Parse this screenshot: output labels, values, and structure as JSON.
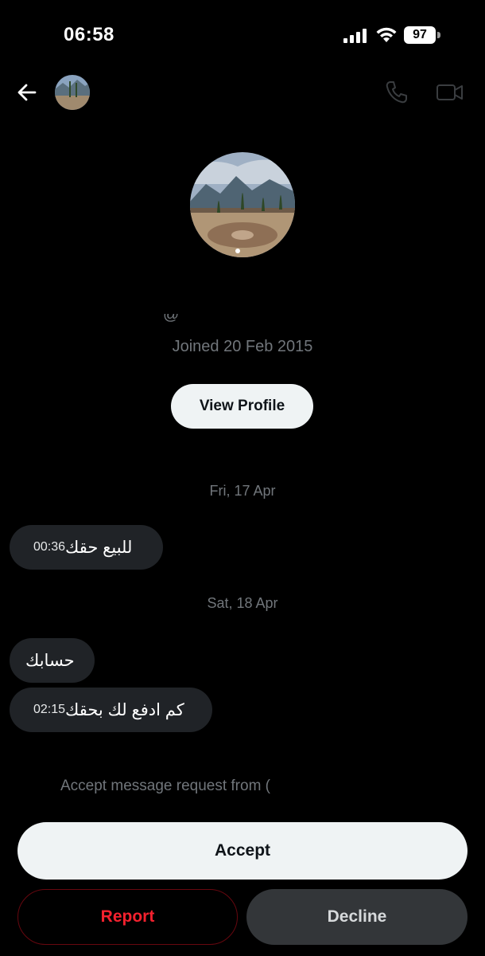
{
  "status_bar": {
    "time": "06:58",
    "battery": "97"
  },
  "header": {
    "back_icon": "arrow-left-icon",
    "call_icon": "phone-icon",
    "video_icon": "video-camera-icon"
  },
  "profile": {
    "handle": "@",
    "joined": "Joined 20 Feb 2015",
    "view_profile_label": "View Profile"
  },
  "conversation": {
    "groups": [
      {
        "date": "Fri, 17 Apr",
        "messages": [
          {
            "text": "للبيع حقك",
            "time": "00:36"
          }
        ]
      },
      {
        "date": "Sat, 18 Apr",
        "messages": [
          {
            "text": "حسابك",
            "time": ""
          },
          {
            "text": "كم ادفع لك بحقك",
            "time": "02:15"
          }
        ]
      }
    ]
  },
  "request": {
    "prompt": "Accept message request from (",
    "accept_label": "Accept",
    "report_label": "Report",
    "decline_label": "Decline"
  },
  "colors": {
    "background": "#000000",
    "bubble": "#202327",
    "report_red": "#f4212e",
    "muted": "#71767b"
  }
}
